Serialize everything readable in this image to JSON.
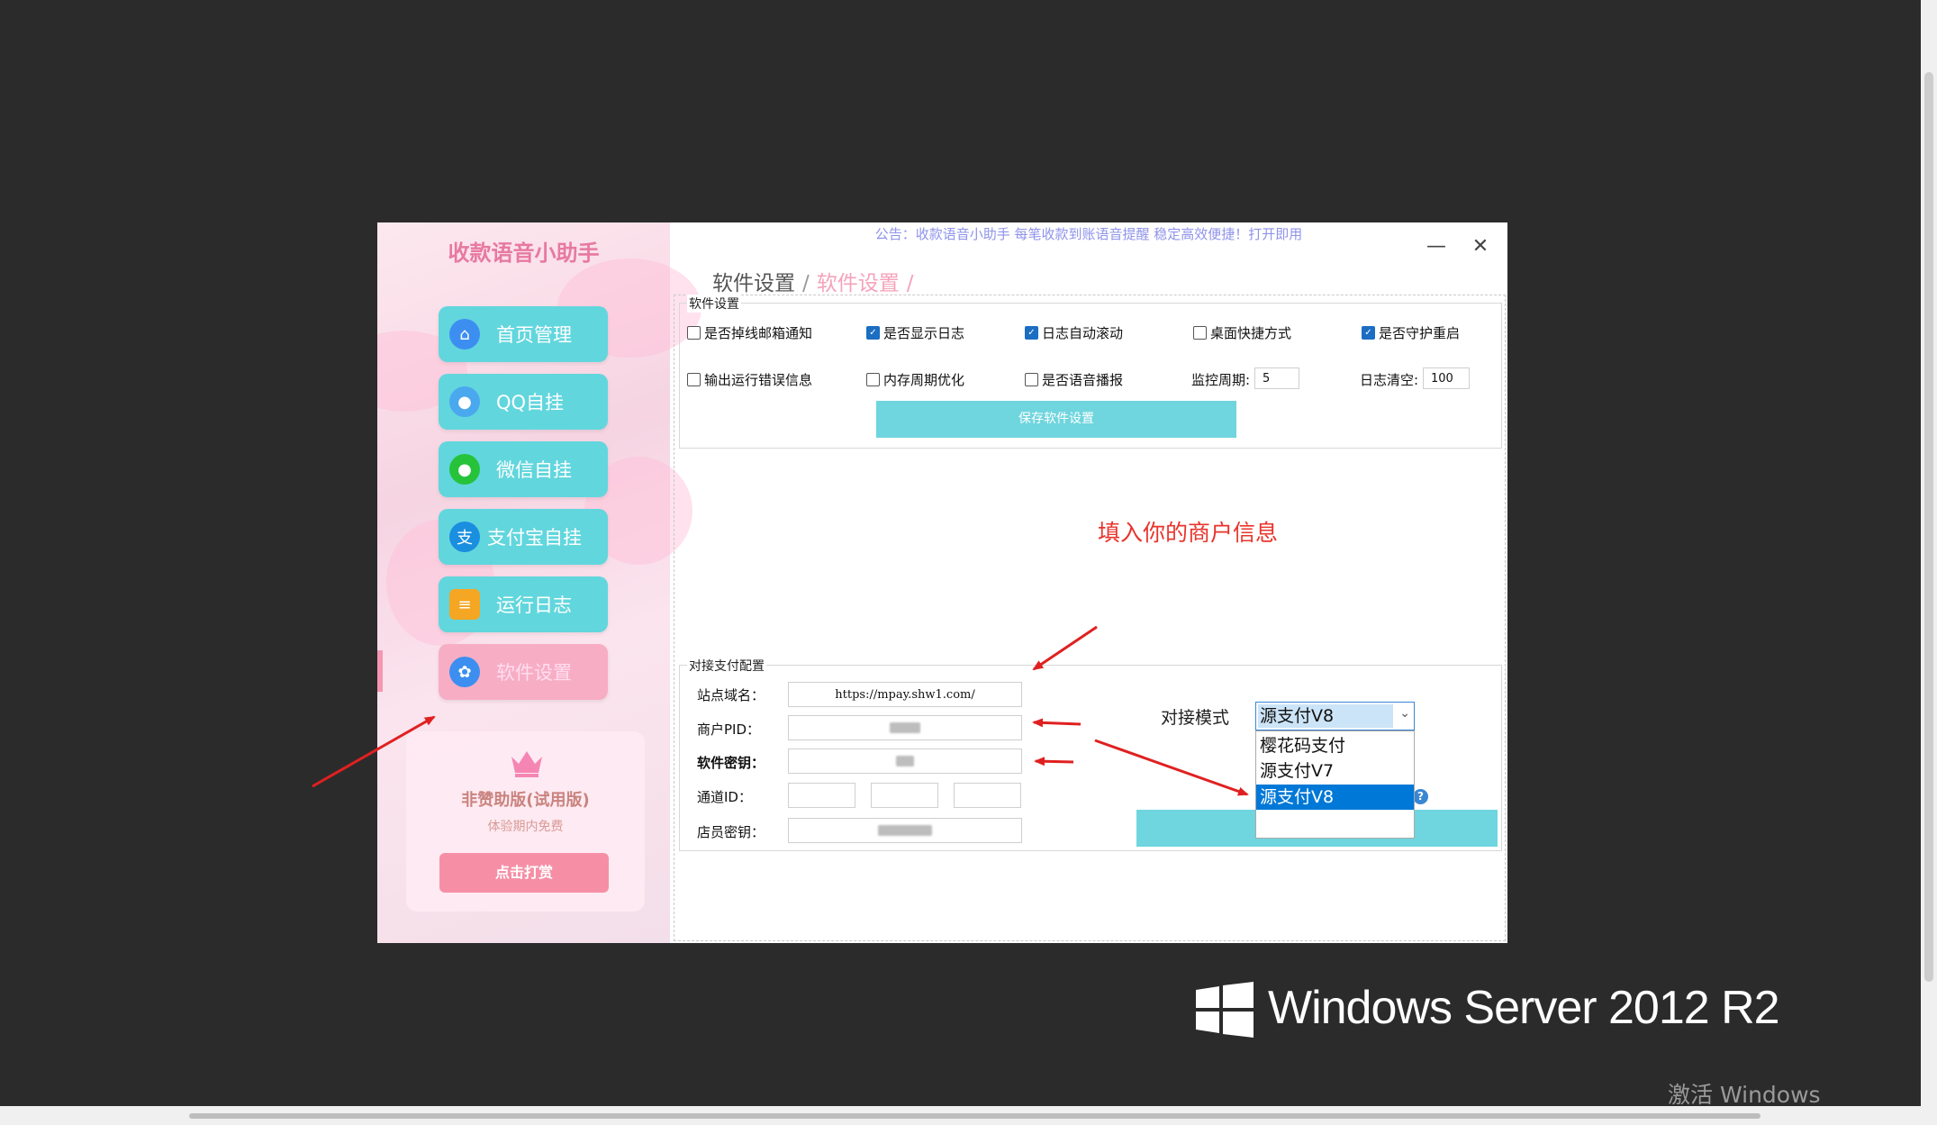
{
  "app": {
    "title": "收款语音小助手",
    "announcement": "公告：收款语音小助手 每笔收款到账语音提醒 稳定高效便捷！打开即用",
    "minimize_glyph": "—",
    "close_glyph": "✕"
  },
  "sidebar": {
    "items": [
      {
        "label": "首页管理",
        "icon": "home-icon",
        "color": "#3c8ff0"
      },
      {
        "label": "QQ自挂",
        "icon": "qq-icon",
        "color": "#4aa8ee"
      },
      {
        "label": "微信自挂",
        "icon": "wechat-icon",
        "color": "#26c33a"
      },
      {
        "label": "支付宝自挂",
        "icon": "alipay-icon",
        "color": "#1a8fe0"
      },
      {
        "label": "运行日志",
        "icon": "clipboard-icon",
        "color": "#f5a623"
      },
      {
        "label": "软件设置",
        "icon": "gear-icon",
        "color": "#3c8ff0"
      }
    ],
    "promo": {
      "title": "非赞助版(试用版)",
      "subtitle": "体验期内免费",
      "button": "点击打赏"
    }
  },
  "breadcrumb": {
    "parent": "软件设置",
    "sep": "/",
    "current": "软件设置",
    "trailing": "/"
  },
  "software_settings": {
    "group_label": "软件设置",
    "row1": [
      {
        "label": "是否掉线邮箱通知",
        "checked": false
      },
      {
        "label": "是否显示日志",
        "checked": true
      },
      {
        "label": "日志自动滚动",
        "checked": true
      },
      {
        "label": "桌面快捷方式",
        "checked": false
      },
      {
        "label": "是否守护重启",
        "checked": true
      }
    ],
    "row2": [
      {
        "label": "输出运行错误信息",
        "checked": false
      },
      {
        "label": "内存周期优化",
        "checked": false
      },
      {
        "label": "是否语音播报",
        "checked": false
      }
    ],
    "monitor_label": "监控周期:",
    "monitor_value": "5",
    "logclear_label": "日志清空:",
    "logclear_value": "100",
    "save_button": "保存软件设置"
  },
  "hint": "填入你的商户信息",
  "payment_config": {
    "group_label": "对接支付配置",
    "domain_label": "站点域名：",
    "domain_value": "https://mpay.shw1.com/",
    "pid_label": "商户PID：",
    "key_label": "软件密钥：",
    "channel_label": "通道ID：",
    "clerk_label": "店员密钥："
  },
  "mode": {
    "label": "对接模式",
    "selected": "源支付V8",
    "options": [
      "樱花码支付",
      "源支付V7",
      "源支付V8"
    ]
  },
  "os": {
    "name": "Windows Server 2012 R2",
    "activate": "激活 Windows"
  }
}
